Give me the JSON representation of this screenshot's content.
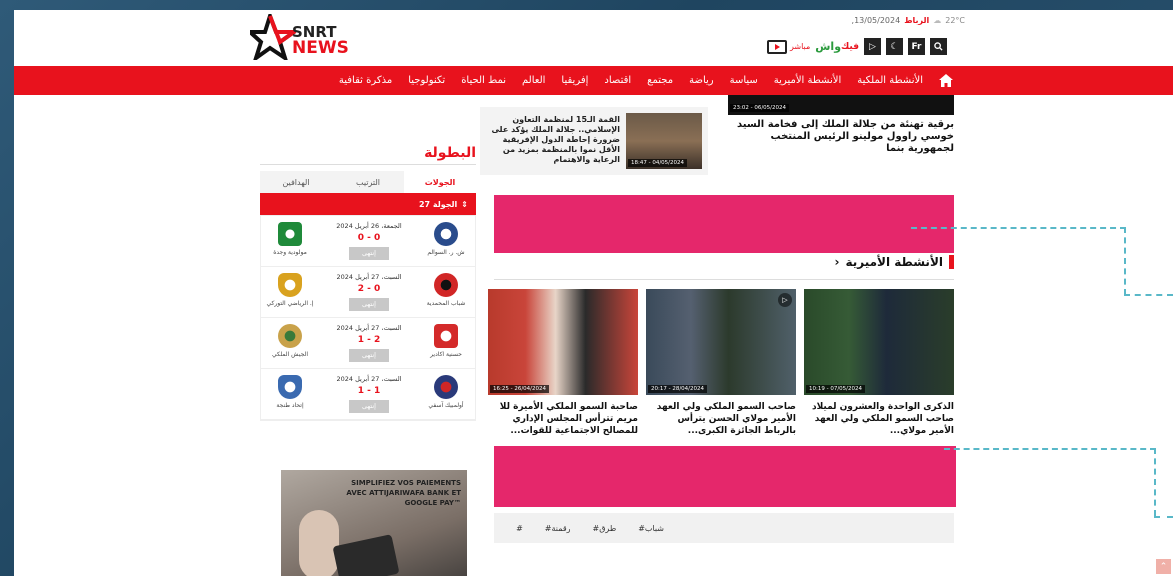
{
  "header": {
    "logo_line1": "SNRT",
    "logo_line2": "NEWS",
    "date": "13/05/2024,",
    "city": "الرباط",
    "temperature": "22°C",
    "live_label": "مباشر",
    "wachi_label": "واش",
    "wachi_sub": "فيك",
    "lang_label": "Fr"
  },
  "nav": {
    "items": [
      "الأنشطة الملكية",
      "الأنشطة الأميرية",
      "سياسة",
      "رياضة",
      "مجتمع",
      "اقتصاد",
      "إفريقيا",
      "العالم",
      "نمط الحياة",
      "تكنولوجيا",
      "مذكرة ثقافية"
    ]
  },
  "sidebar": {
    "league_title": "البطولة",
    "tabs": [
      "الجولات",
      "الترتيب",
      "الهدافين"
    ],
    "round_label": "الجولة 27",
    "matches": [
      {
        "date": "الجمعة، 26 أبريل 2024",
        "score": "0 - 0",
        "status": "إنتهى",
        "home": "ش. ر. السوالم",
        "away": "مولودية وجدة",
        "home_color": "#2a4c8c",
        "away_color": "#1f8a3a"
      },
      {
        "date": "السبت، 27 أبريل 2024",
        "score": "2 - 0",
        "status": "إنتهى",
        "home": "شباب المحمدية",
        "away": "إ. الرياضي التوركي",
        "home_color": "#d12626",
        "away_color": "#d9a21f"
      },
      {
        "date": "السبت، 27 أبريل 2024",
        "score": "1 - 2",
        "status": "إنتهى",
        "home": "حسنية اكادير",
        "away": "الجيش الملكي",
        "home_color": "#d42a2a",
        "away_color": "#c9a24a"
      },
      {
        "date": "السبت، 27 أبريل 2024",
        "score": "1 - 1",
        "status": "إنتهى",
        "home": "أولمبيك آسفي",
        "away": "إتحاد طنجة",
        "home_color": "#2a3a7a",
        "away_color": "#3a6ab0"
      }
    ],
    "ad_text": "SIMPLIFIEZ VOS PAIEMENTS AVEC ATTIJARIWAFA BANK ET GOOGLE PAY™"
  },
  "main": {
    "top_story_time": "23:02 - 06/05/2024",
    "top_story_title": "برقية تهنئة من جلالة الملك إلى فخامة السيد خوسي راوول مولينو الرئيس المنتخب لجمهورية بنما",
    "small_card_time": "18:47 - 04/05/2024",
    "small_card_title": "القمة الـ15 لمنظمة التعاون الإسلامي.. جلالة الملك يؤكد على ضرورة إحاطة الدول الإفريقية الأقل نموا بالمنظمة بمزيد من الرعاية والاهتمام",
    "section_title": "الأنشطة الأميرية",
    "section_chevron": "‹",
    "cards": [
      {
        "time": "10:19 - 07/05/2024",
        "title": "الذكرى الواحدة والعشرون لميلاد صاحب السمو الملكي ولي العهد الأمير مولاي..."
      },
      {
        "time": "20:17 - 28/04/2024",
        "title": "صاحب السمو الملكي ولي العهد الأمير مولاي الحسن يترأس بالرباط الجائزة الكبرى..."
      },
      {
        "time": "16:25 - 26/04/2024",
        "title": "صاحبة السمو الملكي الأميرة للا مريم تترأس المجلس الإداري للمصالح الاجتماعية للقوات..."
      }
    ],
    "tags": [
      "#شباب",
      "#طرق",
      "#رقمنة",
      "#"
    ]
  },
  "colors": {
    "brand_red": "#e8121d",
    "highlight_pink": "#e5276b",
    "dash_cyan": "#59b8c8"
  }
}
